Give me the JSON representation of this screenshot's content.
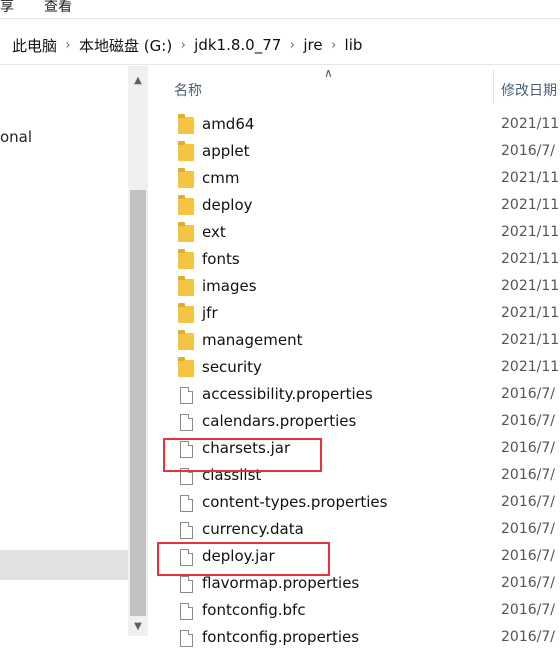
{
  "ribbon": {
    "tabs": [
      "享",
      "查看"
    ]
  },
  "address": {
    "crumbs": [
      "此电脑",
      "本地磁盘 (G:)",
      "jdk1.8.0_77",
      "jre",
      "lib"
    ]
  },
  "nav_pane": {
    "partial_text": "onal"
  },
  "columns": {
    "name": "名称",
    "date": "修改日期"
  },
  "files": [
    {
      "name": "amd64",
      "type": "folder",
      "date": "2021/11"
    },
    {
      "name": "applet",
      "type": "folder",
      "date": "2016/7/"
    },
    {
      "name": "cmm",
      "type": "folder",
      "date": "2021/11"
    },
    {
      "name": "deploy",
      "type": "folder",
      "date": "2021/11"
    },
    {
      "name": "ext",
      "type": "folder",
      "date": "2021/11"
    },
    {
      "name": "fonts",
      "type": "folder",
      "date": "2021/11"
    },
    {
      "name": "images",
      "type": "folder",
      "date": "2021/11"
    },
    {
      "name": "jfr",
      "type": "folder",
      "date": "2021/11"
    },
    {
      "name": "management",
      "type": "folder",
      "date": "2021/11"
    },
    {
      "name": "security",
      "type": "folder",
      "date": "2021/11"
    },
    {
      "name": "accessibility.properties",
      "type": "file",
      "date": "2016/7/"
    },
    {
      "name": "calendars.properties",
      "type": "file",
      "date": "2016/7/"
    },
    {
      "name": "charsets.jar",
      "type": "file",
      "date": "2016/7/",
      "highlighted": true
    },
    {
      "name": "classlist",
      "type": "file",
      "date": "2016/7/"
    },
    {
      "name": "content-types.properties",
      "type": "file",
      "date": "2016/7/"
    },
    {
      "name": "currency.data",
      "type": "file",
      "date": "2016/7/"
    },
    {
      "name": "deploy.jar",
      "type": "file",
      "date": "2016/7/",
      "highlighted": true
    },
    {
      "name": "flavormap.properties",
      "type": "file",
      "date": "2016/7/"
    },
    {
      "name": "fontconfig.bfc",
      "type": "file",
      "date": "2016/7/"
    },
    {
      "name": "fontconfig.properties",
      "type": "file",
      "date": "2016/7/"
    }
  ],
  "colors": {
    "highlight": "#e8313b",
    "folder": "#f4c542",
    "header_text": "#4c607a"
  }
}
